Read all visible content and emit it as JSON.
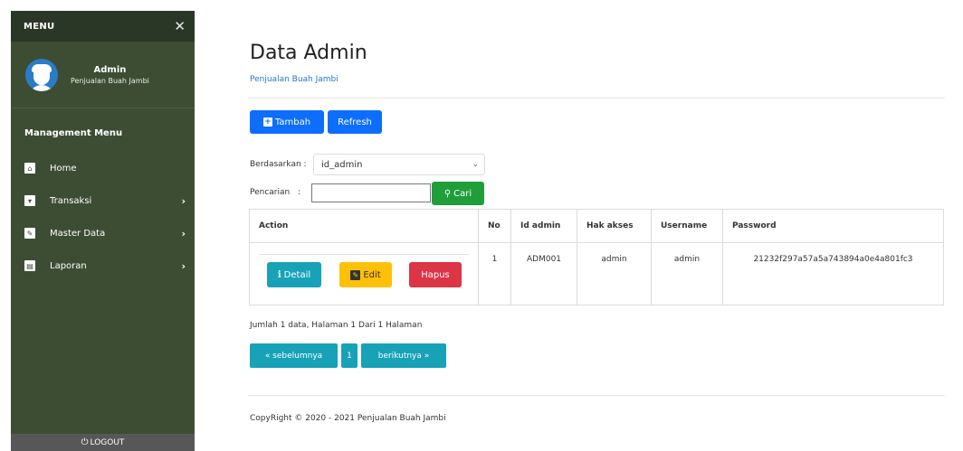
{
  "sidebar": {
    "menu_title": "MENU",
    "close_glyph": "✕",
    "user": {
      "name": "Admin",
      "subtitle": "Penjualan Buah Jambi"
    },
    "section_title": "Management Menu",
    "items": [
      {
        "label": "Home",
        "icon": "home-icon",
        "glyph": "⌂",
        "has_chevron": false
      },
      {
        "label": "Transaksi",
        "icon": "cart-icon",
        "glyph": "▾",
        "has_chevron": true
      },
      {
        "label": "Master Data",
        "icon": "edit-icon",
        "glyph": "✎",
        "has_chevron": true
      },
      {
        "label": "Laporan",
        "icon": "file-icon",
        "glyph": "▤",
        "has_chevron": true
      }
    ],
    "chevron_glyph": "›",
    "logout_label": "LOGOUT",
    "colors": {
      "background": "#3d4d33",
      "header": "#2b3726",
      "logout": "#575757"
    }
  },
  "page": {
    "title": "Data Admin",
    "subtitle": "Penjualan Buah Jambi"
  },
  "toolbar": {
    "add_label": "Tambah",
    "refresh_label": "Refresh"
  },
  "filter": {
    "by_label": "Berdasarkan :",
    "by_value": "id_admin",
    "search_label": "Pencarian   :",
    "search_value": "",
    "search_button": "Cari"
  },
  "table": {
    "headers": [
      "Action",
      "No",
      "Id admin",
      "Hak akses",
      "Username",
      "Password"
    ],
    "rows": [
      {
        "actions": {
          "detail": "Detail",
          "edit": "Edit",
          "hapus": "Hapus"
        },
        "no": "1",
        "id_admin": "ADM001",
        "hak_akses": "admin",
        "username": "admin",
        "password": "21232f297a57a5a743894a0e4a801fc3"
      }
    ]
  },
  "summary": "Jumlah 1 data, Halaman 1 Dari 1 Halaman",
  "pagination": {
    "prev": "« sebelumnya",
    "current": "1",
    "next": "berikutnya »"
  },
  "footer": "CopyRight © 2020 - 2021 Penjualan Buah Jambi",
  "colors": {
    "primary": "#0d6efd",
    "success": "#1f9e3a",
    "info": "#17a2b8",
    "warning": "#ffc107",
    "danger": "#dc3545"
  }
}
